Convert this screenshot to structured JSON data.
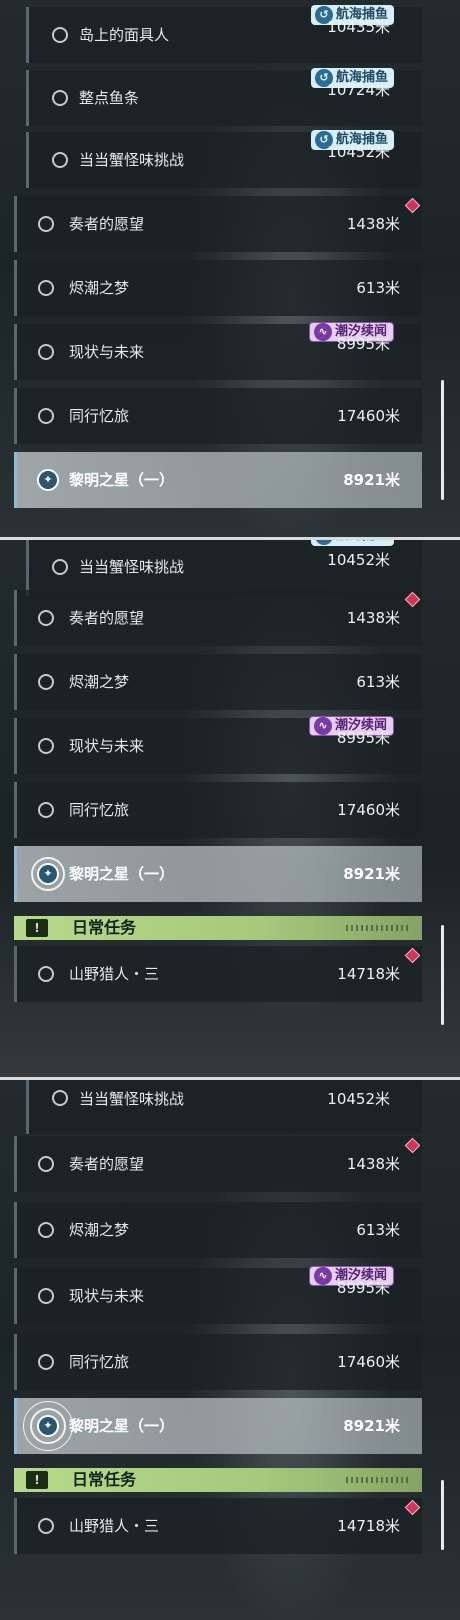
{
  "tags": {
    "fish": "航海捕鱼",
    "tide": "潮汐续闻"
  },
  "section": {
    "daily": "日常任务",
    "icon_text": "!"
  },
  "quests": {
    "mask": {
      "title": "岛上的面具人",
      "dist": "10435米"
    },
    "fish_bar": {
      "title": "整点鱼条",
      "dist": "10724米"
    },
    "crab": {
      "title": "当当蟹怪味挑战",
      "dist": "10452米"
    },
    "player": {
      "title": "奏者的愿望",
      "dist": "1438米"
    },
    "tide_dream": {
      "title": "烬潮之梦",
      "dist": "613米"
    },
    "now_future": {
      "title": "现状与未来",
      "dist": "8995米"
    },
    "journey": {
      "title": "同行忆旅",
      "dist": "17460米"
    },
    "dawn_star": {
      "title": "黎明之星（一）",
      "dist": "8921米"
    },
    "hunter": {
      "title": "山野猎人・三",
      "dist": "14718米"
    }
  },
  "icons": {
    "fish_tag": "fish-hook-icon",
    "tide_tag": "wave-icon",
    "active": "compass-star-icon",
    "daily": "exclamation-icon",
    "alert": "red-diamond-icon"
  }
}
